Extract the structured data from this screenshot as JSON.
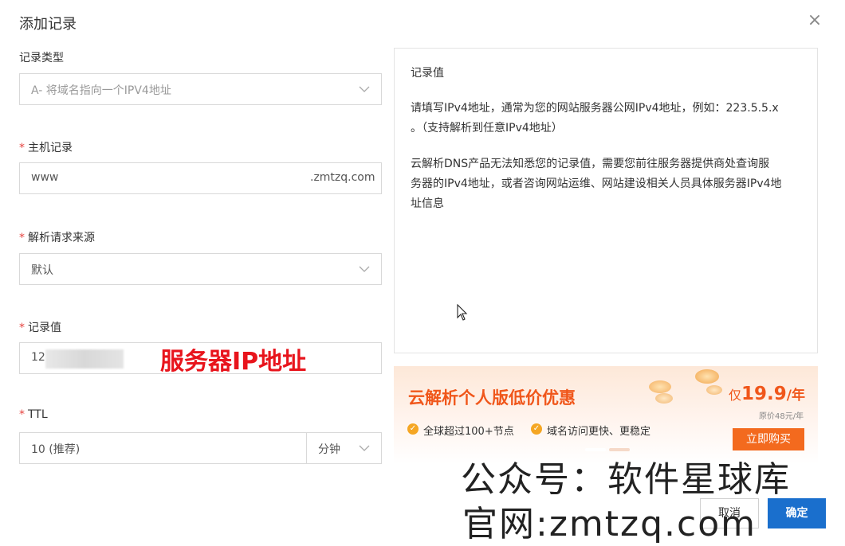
{
  "dialog": {
    "title": "添加记录",
    "close_symbol": "×"
  },
  "form": {
    "record_type": {
      "label": "记录类型",
      "value": "A- 将域名指向一个IPV4地址"
    },
    "host": {
      "label": "主机记录",
      "value": "www",
      "suffix": ".zmtzq.com"
    },
    "source": {
      "label": "解析请求来源",
      "value": "默认"
    },
    "record_value": {
      "label": "记录值",
      "value": "12",
      "annotation": "服务器IP地址"
    },
    "ttl": {
      "label": "TTL",
      "value": "10 (推荐)",
      "unit": "分钟"
    },
    "required_mark": "*"
  },
  "help": {
    "title": "记录值",
    "para1_line1": "请填写IPv4地址，通常为您的网站服务器公网IPv4地址，例如：223.5.5.x",
    "para1_line2": "。（支持解析到任意IPv4地址）",
    "para2_line1": "云解析DNS产品无法知悉您的记录值，需要您前往服务器提供商处查询服",
    "para2_line2": "务器的IPv4地址，或者咨询网站运维、网站建设相关人员具体服务器IPv4地",
    "para2_line3": "址信息"
  },
  "promo": {
    "title": "云解析个人版低价优惠",
    "price_prefix": "仅",
    "price": "19.9",
    "price_unit": "/年",
    "original_price": "原价48元/年",
    "feature1": "全球超过100+节点",
    "feature2": "域名访问更快、更稳定",
    "buy_label": "立即购买",
    "accent": "#f0561a"
  },
  "footer": {
    "cancel_label": "取消",
    "ok_label": "确定"
  },
  "watermark": {
    "line1": "公众号：软件星球库",
    "line2": "官网:zmtzq.com"
  }
}
